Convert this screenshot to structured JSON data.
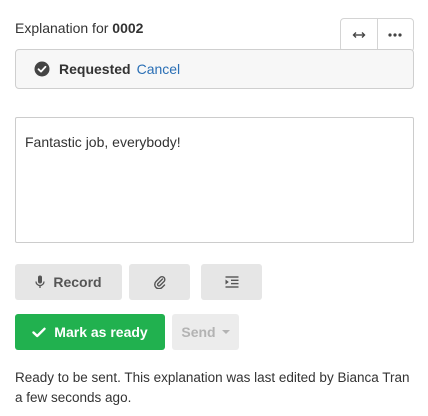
{
  "header": {
    "title_prefix": "Explanation for",
    "title_id": "0002"
  },
  "top_actions": [
    {
      "icon": "expand-horizontal-icon"
    },
    {
      "icon": "more-options-icon"
    }
  ],
  "status": {
    "label": "Requested",
    "cancel_label": "Cancel",
    "icon": "check-circle-icon"
  },
  "editor": {
    "value": "Fantastic job, everybody!"
  },
  "tools": {
    "record_label": "Record",
    "record_icon": "microphone-icon",
    "attach_icon": "paperclip-icon",
    "indent_icon": "indent-icon"
  },
  "actions": {
    "mark_ready_label": "Mark as ready",
    "mark_ready_icon": "checkmark-icon",
    "send_label": "Send",
    "send_caret_icon": "caret-down-icon"
  },
  "footer": {
    "text": "Ready to be sent. This explanation was last edited by Bianca Tran a few seconds ago."
  },
  "colors": {
    "accent_green": "#21b14f",
    "link_blue": "#2a6fb5",
    "button_gray": "#e6e6e6"
  }
}
